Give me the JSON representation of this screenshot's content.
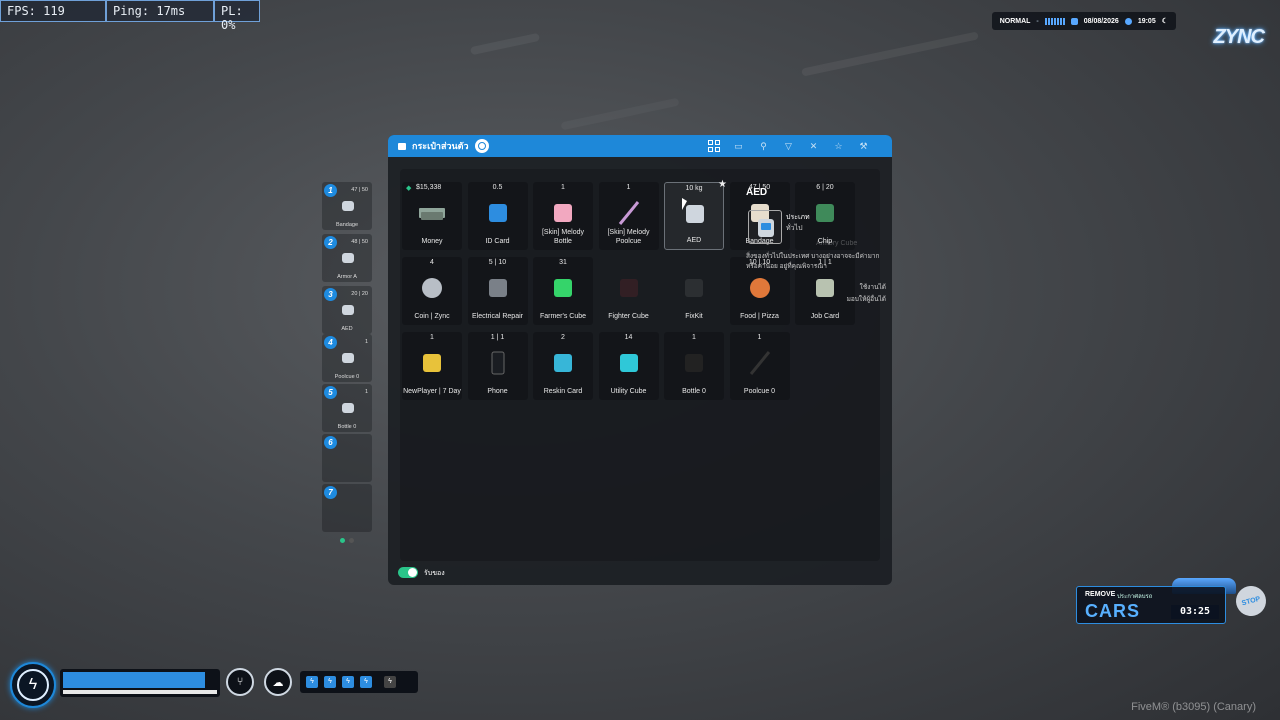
{
  "debug": {
    "fps": "FPS: 119",
    "ping": "Ping: 17ms",
    "pl": "PL: 0%"
  },
  "status": {
    "mode": "NORMAL",
    "sep": "-",
    "date": "08/08/2026",
    "time": "19:05"
  },
  "logo": "ZYNC",
  "hotbar": [
    {
      "num": "1",
      "count": "47 | 50",
      "label": "Bandage"
    },
    {
      "num": "2",
      "count": "48 | 50",
      "label": "Armor A"
    },
    {
      "num": "3",
      "count": "20 | 20",
      "label": "AED"
    },
    {
      "num": "4",
      "count": "1",
      "label": "Poolcue 0"
    },
    {
      "num": "5",
      "count": "1",
      "label": "Bottle 0"
    },
    {
      "num": "6",
      "count": "",
      "label": ""
    },
    {
      "num": "7",
      "count": "",
      "label": ""
    }
  ],
  "inventory": {
    "title": "กระเป๋าส่วนตัว",
    "items": [
      {
        "count": "$15,338",
        "name": "Money"
      },
      {
        "count": "0.5",
        "name": "ID Card"
      },
      {
        "count": "1",
        "name": "[Skin] Melody Bottle"
      },
      {
        "count": "1",
        "name": "[Skin] Melody Poolcue"
      },
      {
        "count": "10 kg",
        "name": "AED"
      },
      {
        "count": "47 | 50",
        "name": "Bandage"
      },
      {
        "count": "6 | 20",
        "name": "Chip"
      },
      {
        "count": "4",
        "name": "Coin | Zync"
      },
      {
        "count": "5 | 10",
        "name": "Electrical Repair"
      },
      {
        "count": "31",
        "name": "Farmer's Cube"
      },
      {
        "count": "",
        "name": "Fighter Cube"
      },
      {
        "count": "",
        "name": "FixKit"
      },
      {
        "count": "10 | 10",
        "name": "Food | Pizza"
      },
      {
        "count": "1 | 1",
        "name": "Job Card"
      },
      {
        "count": "1",
        "name": "NewPlayer | 7 Day"
      },
      {
        "count": "1 | 1",
        "name": "Phone"
      },
      {
        "count": "2",
        "name": "Reskin Card"
      },
      {
        "count": "14",
        "name": "Utility Cube"
      },
      {
        "count": "1",
        "name": "Bottle 0"
      },
      {
        "count": "1",
        "name": "Poolcue 0"
      }
    ],
    "footer_toggle_label": "รับของ"
  },
  "detail": {
    "title": "AED",
    "type_label": "ประเภท",
    "type_value": "ทั่วไป",
    "description": "สิ่งของทั่วไปในประเทศ บางอย่างอาจจะมีค่ามาก หรือค่าน้อย อยู่ที่คุณพิจารณา",
    "use": "ใช้งานได้",
    "give": "มอบให้ผู้อื่นได้",
    "ghost_name": "Armory Cube"
  },
  "hud": {
    "health_fill": 0.92
  },
  "event": {
    "remove": "REMOVE",
    "sub": "ประกาศลบรถ",
    "title": "CARS",
    "timer": "03:25",
    "stop": "STOP"
  },
  "fivem": "FiveM® (b3095) (Canary)",
  "colors": {
    "accent": "#1e88d9",
    "toggle_on": "#2ac58a"
  }
}
